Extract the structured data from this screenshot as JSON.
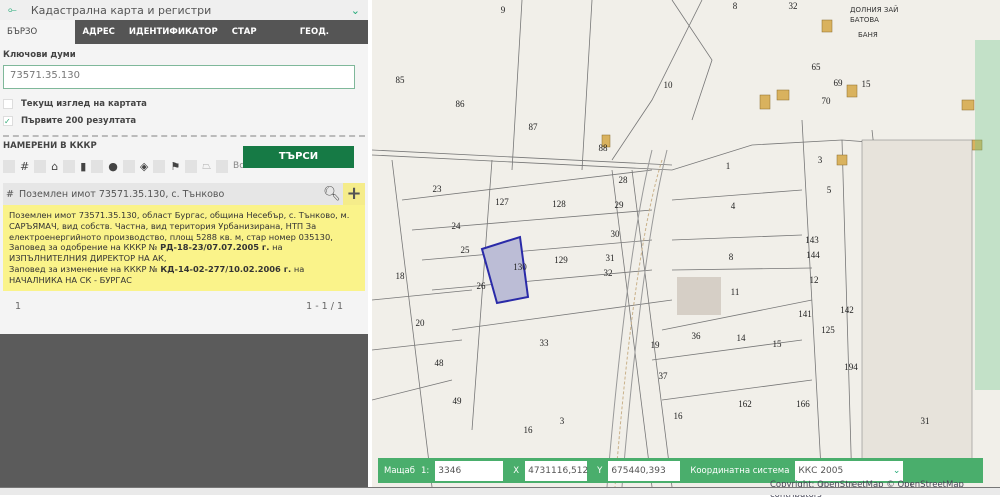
{
  "app": {
    "title": "Кадастрална карта и регистри"
  },
  "tabs": [
    "БЪРЗО ТЪРСЕНЕ",
    "АДРЕС",
    "ИДЕНТИФИКАТОР",
    "СТАР ИДЕНТ.",
    "ГЕОД. ОСНОВА"
  ],
  "search": {
    "keywords_label": "Ключови думи",
    "keywords_value": "73571.35.130",
    "current_view_label": "Текущ изглед на картата",
    "current_view_checked": false,
    "first200_label": "Първите 200 резултата",
    "first200_checked": true,
    "button": "ТЪРСИ"
  },
  "found": {
    "heading": "НАМЕРЕНИ В КККР",
    "all_label": "Всички",
    "filter_icons": [
      "grid-icon",
      "home-icon",
      "building-icon",
      "pin-icon",
      "layers-icon",
      "flag-icon",
      "polygon-icon"
    ]
  },
  "result": {
    "title": "Поземлен имот 73571.35.130, с. Тънково",
    "desc1": "Поземлен имот 73571.35.130, област Бургас, община Несебър, с. Тънково, м. САРЪЯМАЧ, вид собств. Частна, вид територия Урбанизирана, НТП За електроенергийното производство, площ 5288 кв. м, стар номер 035130,",
    "desc2a": "Заповед за одобрение на КККР №",
    "desc2b": "РД-18-23/07.07.2005 г.",
    "desc2c": "на ИЗПЪЛНИТЕЛНИЯ ДИРЕКТОР НА АК,",
    "desc3a": "Заповед за изменение на КККР №",
    "desc3b": "КД-14-02-277/10.02.2006 г.",
    "desc3c": "на НАЧАЛНИКА НА СК - БУРГАС"
  },
  "pager": {
    "page": "1",
    "range": "1 - 1 / 1"
  },
  "map": {
    "labels": [
      [
        "9",
        503,
        10
      ],
      [
        "8",
        735,
        6
      ],
      [
        "32",
        793,
        6
      ],
      [
        "85",
        400,
        80
      ],
      [
        "86",
        460,
        104
      ],
      [
        "87",
        533,
        127
      ],
      [
        "10",
        668,
        85
      ],
      [
        "65",
        816,
        67
      ],
      [
        "69",
        838,
        83
      ],
      [
        "15",
        866,
        84
      ],
      [
        "70",
        826,
        101
      ],
      [
        "88",
        603,
        148
      ],
      [
        "1",
        728,
        166
      ],
      [
        "3",
        820,
        160
      ],
      [
        "28",
        623,
        180
      ],
      [
        "127",
        502,
        202
      ],
      [
        "128",
        559,
        204
      ],
      [
        "23",
        437,
        189
      ],
      [
        "29",
        619,
        205
      ],
      [
        "24",
        456,
        226
      ],
      [
        "30",
        615,
        234
      ],
      [
        "4",
        733,
        206
      ],
      [
        "5",
        829,
        190
      ],
      [
        "25",
        465,
        250
      ],
      [
        "130",
        520,
        267
      ],
      [
        "129",
        561,
        260
      ],
      [
        "31",
        610,
        258
      ],
      [
        "32",
        608,
        273
      ],
      [
        "8",
        731,
        257
      ],
      [
        "143",
        812,
        240
      ],
      [
        "144",
        813,
        255
      ],
      [
        "18",
        400,
        276
      ],
      [
        "26",
        481,
        286
      ],
      [
        "11",
        735,
        292
      ],
      [
        "12",
        814,
        280
      ],
      [
        "141",
        805,
        314
      ],
      [
        "142",
        847,
        310
      ],
      [
        "20",
        420,
        323
      ],
      [
        "33",
        544,
        343
      ],
      [
        "19",
        655,
        345
      ],
      [
        "36",
        696,
        336
      ],
      [
        "14",
        741,
        338
      ],
      [
        "15",
        777,
        344
      ],
      [
        "125",
        828,
        330
      ],
      [
        "48",
        439,
        363
      ],
      [
        "37",
        663,
        376
      ],
      [
        "194",
        851,
        367
      ],
      [
        "49",
        457,
        401
      ],
      [
        "162",
        745,
        404
      ],
      [
        "166",
        803,
        404
      ],
      [
        "16",
        678,
        416
      ],
      [
        "16",
        528,
        430
      ],
      [
        "3",
        562,
        421
      ],
      [
        "31",
        925,
        421
      ]
    ],
    "highlight": "130",
    "copyright": "Copyright: OpenStreetMap © OpenStreetMap contributors",
    "place_labels": [
      "ДОЛНИЯ ЗАЙ",
      "БАТОВА",
      "БАНЯ"
    ]
  },
  "bottom": {
    "scale_label": "Мащаб",
    "scale_prefix": "1:",
    "scale": "3346",
    "x_label": "X",
    "x": "4731116,512",
    "y_label": "Y",
    "y": "675440,393",
    "crs_label": "Координатна система",
    "crs": "ККС 2005"
  }
}
